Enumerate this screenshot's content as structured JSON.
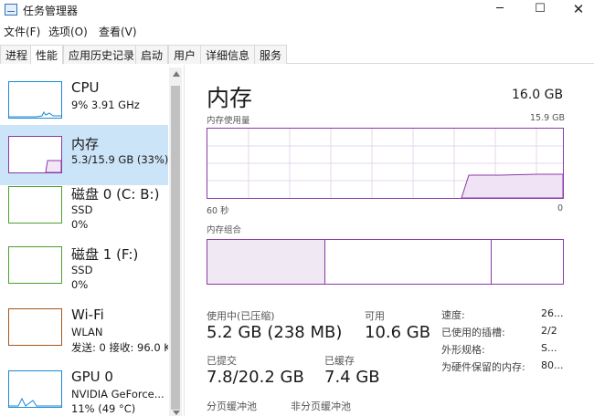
{
  "window": {
    "title": "任务管理器",
    "minimize_glyph": "─",
    "maximize_glyph": "☐",
    "close_glyph": "✕"
  },
  "menu": {
    "file": "文件(F)",
    "options": "选项(O)",
    "view": "查看(V)"
  },
  "tabs": [
    {
      "label": "进程"
    },
    {
      "label": "性能"
    },
    {
      "label": "应用历史记录"
    },
    {
      "label": "启动"
    },
    {
      "label": "用户"
    },
    {
      "label": "详细信息"
    },
    {
      "label": "服务"
    }
  ],
  "active_tab": "性能",
  "sidebar": {
    "items": [
      {
        "title": "CPU",
        "line1": "9% 3.91 GHz",
        "line2": "",
        "color": "#1b8ad6"
      },
      {
        "title": "内存",
        "line1": "5.3/15.9 GB (33%)",
        "line2": "",
        "color": "#8a3aa8"
      },
      {
        "title": "磁盘 0 (C: B:)",
        "line1": "SSD",
        "line2": "0%",
        "color": "#4aa02c"
      },
      {
        "title": "磁盘 1 (F:)",
        "line1": "SSD",
        "line2": "0%",
        "color": "#4aa02c"
      },
      {
        "title": "Wi-Fi",
        "line1": "WLAN",
        "line2": "发送: 0 接收: 96.0 K",
        "color": "#a6561b"
      },
      {
        "title": "GPU 0",
        "line1": "NVIDIA GeForce...",
        "line2": "11% (49 °C)",
        "color": "#1b8ad6"
      }
    ]
  },
  "memory": {
    "title": "内存",
    "total": "16.0 GB",
    "usage_label": "内存使用量",
    "usage_max": "15.9 GB",
    "axis_left": "60 秒",
    "axis_right": "0",
    "composition_label": "内存组合",
    "in_use_label": "使用中(已压缩)",
    "in_use_value": "5.2 GB (238 MB)",
    "available_label": "可用",
    "available_value": "10.6 GB",
    "committed_label": "已提交",
    "committed_value": "7.8/20.2 GB",
    "cached_label": "已缓存",
    "cached_value": "7.4 GB",
    "paged_pool_label": "分页缓冲池",
    "nonpaged_pool_label": "非分页缓冲池",
    "details": [
      {
        "label": "速度:",
        "value": "26..."
      },
      {
        "label": "已使用的插槽:",
        "value": "2/2"
      },
      {
        "label": "外形规格:",
        "value": "S..."
      },
      {
        "label": "为硬件保留的内存:",
        "value": "80..."
      }
    ],
    "accent": "#8a3aa8"
  }
}
